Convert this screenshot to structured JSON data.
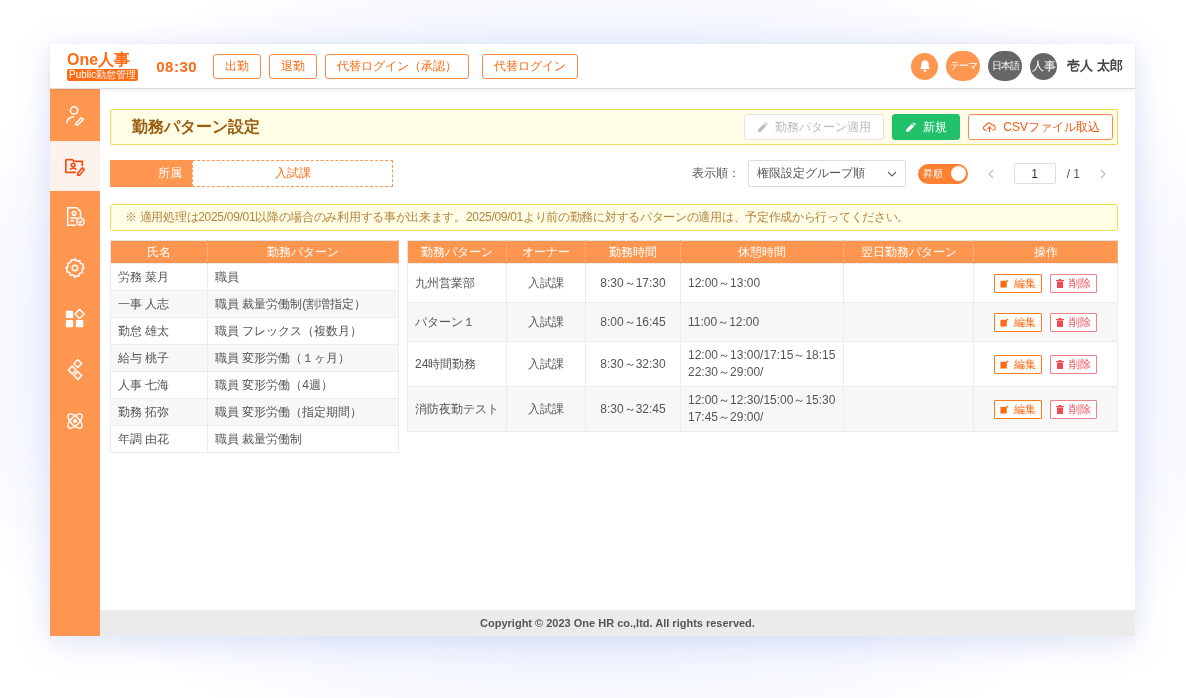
{
  "header": {
    "logo": "One人事",
    "logo_sub": "Public勤怠管理",
    "time": "08:30",
    "buttons": [
      "出勤",
      "退勤",
      "代替ログイン（承認）",
      "代替ログイン"
    ],
    "theme": "テーマ",
    "language": "日本語",
    "avatar": "人事",
    "user_name": "壱人 太郎"
  },
  "sidebar": {
    "items": [
      {
        "selected": false
      },
      {
        "selected": true
      },
      {
        "selected": false
      },
      {
        "selected": false
      },
      {
        "selected": false
      },
      {
        "selected": false
      },
      {
        "selected": false
      }
    ]
  },
  "page_title": "勤務パターン設定",
  "actions": [
    {
      "label": "勤務パターン適用",
      "kind": "apply",
      "disabled": true
    },
    {
      "label": "新規",
      "kind": "new",
      "disabled": false
    },
    {
      "label": "CSVファイル取込",
      "kind": "import",
      "disabled": false
    }
  ],
  "filter": {
    "label": "所属",
    "value": "入試課"
  },
  "sort": {
    "label": "表示順：",
    "value": "権限設定グループ順",
    "toggle_label": "昇順",
    "on": true
  },
  "pagination": {
    "page": "1",
    "total": "/ 1"
  },
  "notice": "※ 適用処理は2025/09/01以降の場合のみ利用する事が出来ます。2025/09/01より前の勤務に対するパターンの適用は、予定作成から行ってください。",
  "members_table": {
    "columns": [
      "氏名",
      "勤務パターン"
    ],
    "rows": [
      [
        "労務 菜月",
        "職員"
      ],
      [
        "一事 人志",
        "職員 裁量労働制(割増指定）"
      ],
      [
        "勤怠 雄太",
        "職員 フレックス（複数月）"
      ],
      [
        "給与 桃子",
        "職員 変形労働（１ヶ月）"
      ],
      [
        "人事 七海",
        "職員 変形労働（4週）"
      ],
      [
        "勤務 拓弥",
        "職員 変形労働（指定期間）"
      ],
      [
        "年調 由花",
        "職員 裁量労働制"
      ]
    ]
  },
  "patterns_table": {
    "columns": [
      "勤務パターン",
      "オーナー",
      "勤務時間",
      "休憩時間",
      "翌日勤務パターン",
      "操作"
    ],
    "rows": [
      {
        "name": "九州営業部",
        "owner": "入試課",
        "hours": "8:30～17:30",
        "breaks": [
          "12:00～13:00"
        ],
        "edit": "編集",
        "delete": "削除"
      },
      {
        "name": "パターン１",
        "owner": "入試課",
        "hours": "8:00～16:45",
        "breaks": [
          "11:00～12:00"
        ],
        "edit": "編集",
        "delete": "削除"
      },
      {
        "name": "24時間勤務",
        "owner": "入試課",
        "hours": "8:30～32:30",
        "breaks": [
          "12:00～13:00/17:15～18:15",
          "22:30～29:00/"
        ],
        "edit": "編集",
        "delete": "削除"
      },
      {
        "name": "消防夜勤テスト",
        "owner": "入試課",
        "hours": "8:30～32:45",
        "breaks": [
          "12:00～12:30/15:00～15:30",
          "17:45～29:00/"
        ],
        "edit": "編集",
        "delete": "削除"
      }
    ]
  },
  "footer": "Copyright © 2023 One HR co.,ltd. All rights reserved."
}
